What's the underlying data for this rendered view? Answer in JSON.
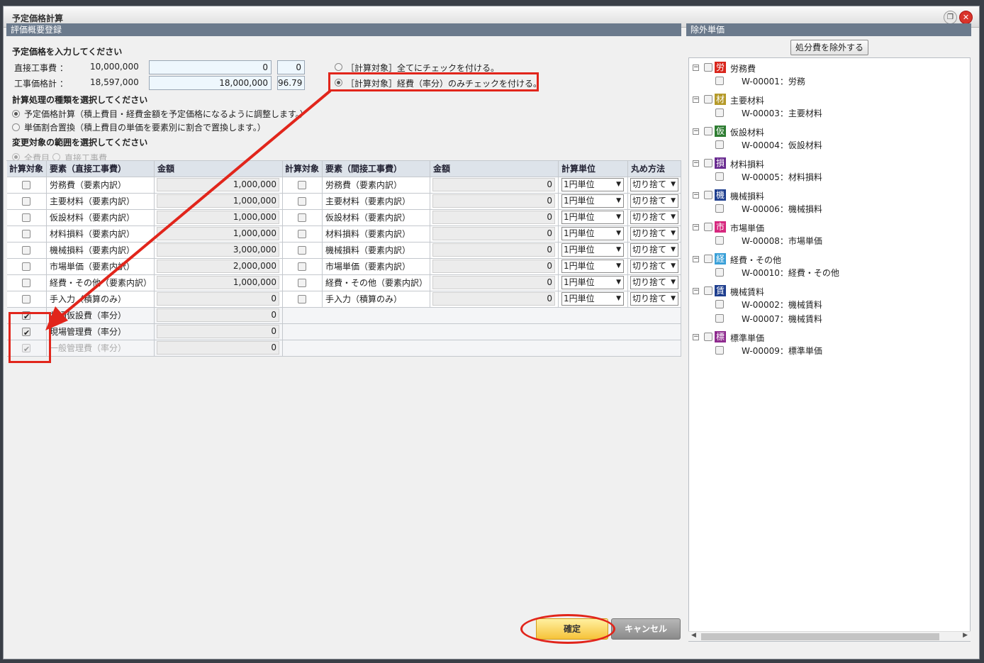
{
  "window": {
    "title": "予定価格計算"
  },
  "left_panel": {
    "header": "評価概要登録",
    "price_section": {
      "label": "予定価格を入力してください",
      "direct_label": "直接工事費 ：",
      "direct_value": "10,000,000",
      "direct_input": "0",
      "direct_ratio": "0",
      "total_label": "工事価格計 ：",
      "total_value": "18,597,000",
      "total_input": "18,000,000",
      "total_ratio": "96.79",
      "option_all": "［計算対象］全てにチェックを付ける。",
      "option_expense": "［計算対象］経費（率分）のみチェックを付ける。"
    },
    "method_section": {
      "label": "計算処理の種類を選択してください",
      "option1": "予定価格計算（積上費目・経費金額を予定価格になるように調整します。）",
      "option2": "単価割合置換（積上費目の単価を要素別に割合で置換します。）"
    },
    "scope_section": {
      "label": "変更対象の範囲を選択してください",
      "option_all": "全費目",
      "option_direct": "直接工事費"
    },
    "table": {
      "headers": [
        "計算対象",
        "要素（直接工事費）",
        "金額",
        "計算対象",
        "要素（間接工事費）",
        "金額",
        "計算単位",
        "丸め方法"
      ],
      "rows": [
        {
          "direct_checked": false,
          "direct_name": "労務費（要素内訳）",
          "direct_amount": "1,000,000",
          "indirect_checked": false,
          "indirect_name": "労務費（要素内訳）",
          "indirect_amount": "0",
          "unit": "1円単位",
          "rounding": "切り捨て"
        },
        {
          "direct_checked": false,
          "direct_name": "主要材料（要素内訳）",
          "direct_amount": "1,000,000",
          "indirect_checked": false,
          "indirect_name": "主要材料（要素内訳）",
          "indirect_amount": "0",
          "unit": "1円単位",
          "rounding": "切り捨て"
        },
        {
          "direct_checked": false,
          "direct_name": "仮設材料（要素内訳）",
          "direct_amount": "1,000,000",
          "indirect_checked": false,
          "indirect_name": "仮設材料（要素内訳）",
          "indirect_amount": "0",
          "unit": "1円単位",
          "rounding": "切り捨て"
        },
        {
          "direct_checked": false,
          "direct_name": "材料損料（要素内訳）",
          "direct_amount": "1,000,000",
          "indirect_checked": false,
          "indirect_name": "材料損料（要素内訳）",
          "indirect_amount": "0",
          "unit": "1円単位",
          "rounding": "切り捨て"
        },
        {
          "direct_checked": false,
          "direct_name": "機械損料（要素内訳）",
          "direct_amount": "3,000,000",
          "indirect_checked": false,
          "indirect_name": "機械損料（要素内訳）",
          "indirect_amount": "0",
          "unit": "1円単位",
          "rounding": "切り捨て"
        },
        {
          "direct_checked": false,
          "direct_name": "市場単価（要素内訳）",
          "direct_amount": "2,000,000",
          "indirect_checked": false,
          "indirect_name": "市場単価（要素内訳）",
          "indirect_amount": "0",
          "unit": "1円単位",
          "rounding": "切り捨て"
        },
        {
          "direct_checked": false,
          "direct_name": "経費・その他（要素内訳）",
          "direct_amount": "1,000,000",
          "indirect_checked": false,
          "indirect_name": "経費・その他（要素内訳）",
          "indirect_amount": "0",
          "unit": "1円単位",
          "rounding": "切り捨て"
        },
        {
          "direct_checked": false,
          "direct_name": "手入力（積算のみ）",
          "direct_amount": "0",
          "indirect_checked": false,
          "indirect_name": "手入力（積算のみ）",
          "indirect_amount": "0",
          "unit": "1円単位",
          "rounding": "切り捨て"
        }
      ],
      "extra_rows": [
        {
          "checked": true,
          "disabled": false,
          "name": "共通仮設費（率分）",
          "amount": "0"
        },
        {
          "checked": true,
          "disabled": false,
          "name": "現場管理費（率分）",
          "amount": "0"
        },
        {
          "checked": true,
          "disabled": true,
          "name": "一般管理費（率分）",
          "amount": "0"
        }
      ]
    }
  },
  "right_panel": {
    "header": "除外単価",
    "exclude_button": "処分費を除外する",
    "tree": [
      {
        "icon": "労",
        "color": "#d9261c",
        "label": "労務費",
        "children": [
          "W-00001：労務"
        ]
      },
      {
        "icon": "材",
        "color": "#b59a2a",
        "label": "主要材料",
        "children": [
          "W-00003：主要材料"
        ]
      },
      {
        "icon": "仮",
        "color": "#2e7d32",
        "label": "仮設材料",
        "children": [
          "W-00004：仮設材料"
        ]
      },
      {
        "icon": "損",
        "color": "#6a2c91",
        "label": "材料損料",
        "children": [
          "W-00005：材料損料"
        ]
      },
      {
        "icon": "機",
        "color": "#1f3f8f",
        "label": "機械損料",
        "children": [
          "W-00006：機械損料"
        ]
      },
      {
        "icon": "市",
        "color": "#d6287e",
        "label": "市場単価",
        "children": [
          "W-00008：市場単価"
        ]
      },
      {
        "icon": "経",
        "color": "#3aa0d8",
        "label": "経費・その他",
        "children": [
          "W-00010：経費・その他"
        ]
      },
      {
        "icon": "賃",
        "color": "#1f3f8f",
        "label": "機械賃料",
        "children": [
          "W-00002：機械賃料",
          "W-00007：機械賃料"
        ]
      },
      {
        "icon": "標",
        "color": "#8e2a8e",
        "label": "標準単価",
        "children": [
          "W-00009：標準単価"
        ]
      }
    ]
  },
  "footer": {
    "ok": "確定",
    "cancel": "キャンセル"
  },
  "colors": {
    "annotation": "#e1251b",
    "header": "#6b7a8c",
    "ok_button": "#f6c33a"
  }
}
